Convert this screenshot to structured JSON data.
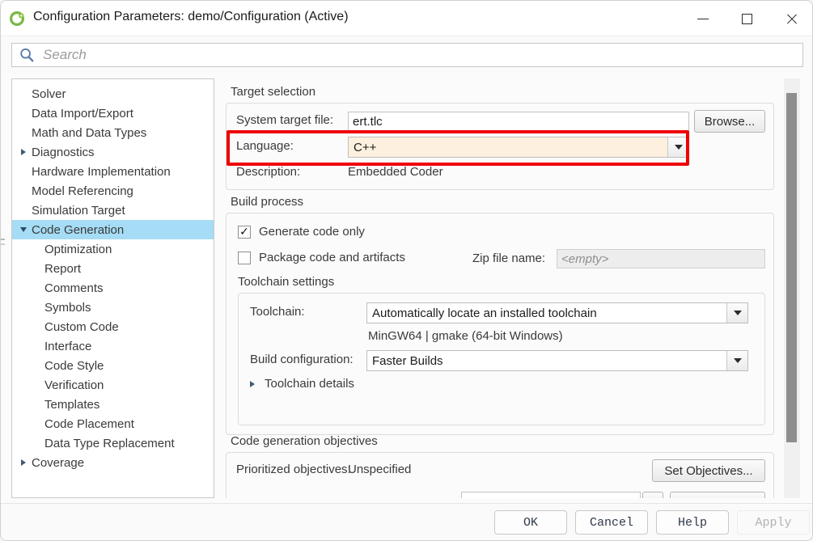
{
  "window": {
    "title": "Configuration Parameters: demo/Configuration (Active)",
    "icon": "simulink-icon",
    "minimize_label": "Minimize",
    "maximize_label": "Maximize",
    "close_label": "Close"
  },
  "search": {
    "placeholder": "Search",
    "value": "",
    "icon": "search-icon"
  },
  "sidebar": {
    "items": [
      {
        "label": "Solver",
        "indent": 0,
        "arrow": "none",
        "selected": false
      },
      {
        "label": "Data Import/Export",
        "indent": 0,
        "arrow": "none",
        "selected": false
      },
      {
        "label": "Math and Data Types",
        "indent": 0,
        "arrow": "none",
        "selected": false
      },
      {
        "label": "Diagnostics",
        "indent": 0,
        "arrow": "collapsed",
        "selected": false
      },
      {
        "label": "Hardware Implementation",
        "indent": 0,
        "arrow": "none",
        "selected": false
      },
      {
        "label": "Model Referencing",
        "indent": 0,
        "arrow": "none",
        "selected": false
      },
      {
        "label": "Simulation Target",
        "indent": 0,
        "arrow": "none",
        "selected": false
      },
      {
        "label": "Code Generation",
        "indent": 0,
        "arrow": "expanded",
        "selected": true
      },
      {
        "label": "Optimization",
        "indent": 1,
        "arrow": "none",
        "selected": false
      },
      {
        "label": "Report",
        "indent": 1,
        "arrow": "none",
        "selected": false
      },
      {
        "label": "Comments",
        "indent": 1,
        "arrow": "none",
        "selected": false
      },
      {
        "label": "Symbols",
        "indent": 1,
        "arrow": "none",
        "selected": false
      },
      {
        "label": "Custom Code",
        "indent": 1,
        "arrow": "none",
        "selected": false
      },
      {
        "label": "Interface",
        "indent": 1,
        "arrow": "none",
        "selected": false
      },
      {
        "label": "Code Style",
        "indent": 1,
        "arrow": "none",
        "selected": false
      },
      {
        "label": "Verification",
        "indent": 1,
        "arrow": "none",
        "selected": false
      },
      {
        "label": "Templates",
        "indent": 1,
        "arrow": "none",
        "selected": false
      },
      {
        "label": "Code Placement",
        "indent": 1,
        "arrow": "none",
        "selected": false
      },
      {
        "label": "Data Type Replacement",
        "indent": 1,
        "arrow": "none",
        "selected": false
      },
      {
        "label": "Coverage",
        "indent": 0,
        "arrow": "collapsed",
        "selected": false
      }
    ],
    "selection_color": "#a6dcf5"
  },
  "target_selection": {
    "group_title": "Target selection",
    "system_target_file_label": "System target file:",
    "system_target_file_value": "ert.tlc",
    "browse_label": "Browse...",
    "language_label": "Language:",
    "language_value": "C++",
    "language_changed_color": "#fdf0de",
    "description_label": "Description:",
    "description_value": "Embedded Coder"
  },
  "build_process": {
    "group_title": "Build process",
    "generate_code_only_label": "Generate code only",
    "generate_code_only_checked": true,
    "package_code_label": "Package code and artifacts",
    "package_code_checked": false,
    "zip_file_name_label": "Zip file name:",
    "zip_file_name_placeholder": "<empty>",
    "toolchain_settings_title": "Toolchain settings",
    "toolchain_label": "Toolchain:",
    "toolchain_value": "Automatically locate an installed toolchain",
    "toolchain_info": "MinGW64 | gmake (64-bit Windows)",
    "build_configuration_label": "Build configuration:",
    "build_configuration_value": "Faster Builds",
    "toolchain_details_label": "Toolchain details"
  },
  "code_generation_objectives": {
    "group_title": "Code generation objectives",
    "prioritized_objectives_label": "Prioritized objectives:",
    "prioritized_objectives_value": "Unspecified",
    "set_objectives_label": "Set Objectives..."
  },
  "annotation": {
    "highlight_color": "#ef0000",
    "highlight_target": "language-row"
  },
  "footer": {
    "ok_label": "OK",
    "cancel_label": "Cancel",
    "help_label": "Help",
    "apply_label": "Apply",
    "apply_disabled": true
  }
}
